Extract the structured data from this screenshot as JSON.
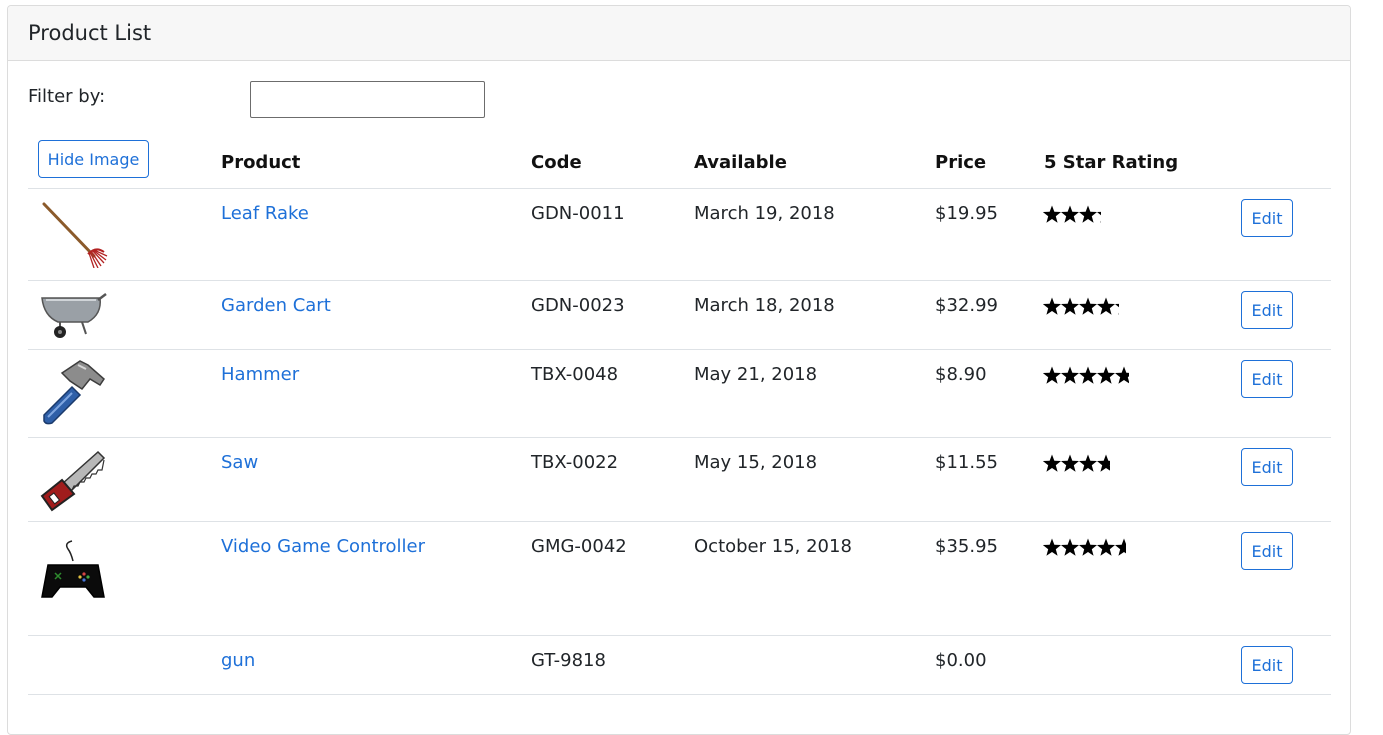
{
  "header": {
    "title": "Product List"
  },
  "filter": {
    "label": "Filter by:",
    "value": ""
  },
  "table": {
    "toggle_image_label": "Hide Image",
    "columns": {
      "product": "Product",
      "code": "Code",
      "available": "Available",
      "price": "Price",
      "rating": "5 Star Rating"
    },
    "edit_label": "Edit",
    "rows": [
      {
        "image": "leaf-rake-image",
        "name": "Leaf Rake",
        "code": "GDN-0011",
        "available": "March 19, 2018",
        "price": "$19.95",
        "rating": 3.2
      },
      {
        "image": "garden-cart-image",
        "name": "Garden Cart",
        "code": "GDN-0023",
        "available": "March 18, 2018",
        "price": "$32.99",
        "rating": 4.2
      },
      {
        "image": "hammer-image",
        "name": "Hammer",
        "code": "TBX-0048",
        "available": "May 21, 2018",
        "price": "$8.90",
        "rating": 4.8
      },
      {
        "image": "saw-image",
        "name": "Saw",
        "code": "TBX-0022",
        "available": "May 15, 2018",
        "price": "$11.55",
        "rating": 3.7
      },
      {
        "image": "game-controller-image",
        "name": "Video Game Controller",
        "code": "GMG-0042",
        "available": "October 15, 2018",
        "price": "$35.95",
        "rating": 4.6
      },
      {
        "image": "",
        "name": "gun",
        "code": "GT-9818",
        "available": "",
        "price": "$0.00",
        "rating": null
      }
    ]
  },
  "colors": {
    "accent": "#1e70d8",
    "border": "#dee2e6",
    "header_bg": "#f7f7f7"
  }
}
